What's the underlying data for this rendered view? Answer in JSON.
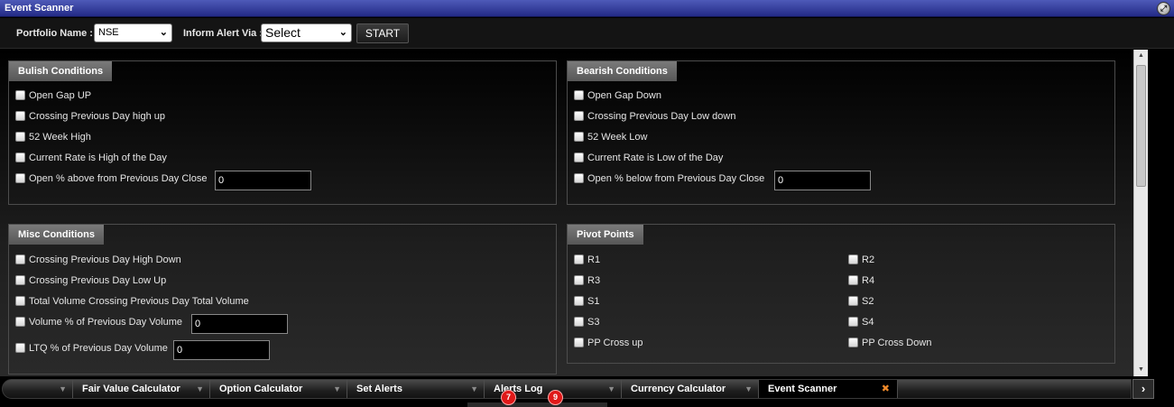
{
  "window": {
    "title": "Event Scanner"
  },
  "toolbar": {
    "portfolio_label": "Portfolio Name :",
    "portfolio_value": "NSE",
    "inform_label": "Inform Alert Via :",
    "inform_value": "Select",
    "start_label": "START"
  },
  "bullish": {
    "title": "Bulish Conditions",
    "items": [
      "Open Gap UP",
      "Crossing Previous Day high up",
      "52 Week High",
      "Current Rate is High of the Day",
      "Open % above from Previous Day Close"
    ],
    "input_value": "0"
  },
  "bearish": {
    "title": "Bearish Conditions",
    "items": [
      "Open Gap Down",
      "Crossing Previous Day Low down",
      "52 Week Low",
      "Current Rate is Low of the Day",
      "Open % below from Previous Day Close"
    ],
    "input_value": "0"
  },
  "misc": {
    "title": "Misc Conditions",
    "items": [
      "Crossing Previous Day High Down",
      "Crossing Previous Day Low Up",
      "Total Volume Crossing Previous Day Total Volume",
      "Volume % of Previous Day Volume",
      "LTQ % of Previous Day Volume"
    ],
    "input1_value": "0",
    "input2_value": "0"
  },
  "pivot": {
    "title": "Pivot Points",
    "left": [
      "R1",
      "R3",
      "S1",
      "S3",
      "PP Cross up"
    ],
    "right": [
      "R2",
      "R4",
      "S2",
      "S4",
      "PP Cross Down"
    ]
  },
  "tabs": [
    "Fair Value Calculator",
    "Option Calculator",
    "Set Alerts",
    "Alerts Log",
    "Currency Calculator",
    "Event Scanner"
  ],
  "badges": [
    "7",
    "9"
  ],
  "icons": {
    "expand": "expand-icon",
    "close": "close-icon",
    "next": "chevron-right-icon"
  },
  "colors": {
    "titlebar": "#2f3a9e",
    "close_accent": "#f08a2a",
    "badge": "#e01818"
  }
}
